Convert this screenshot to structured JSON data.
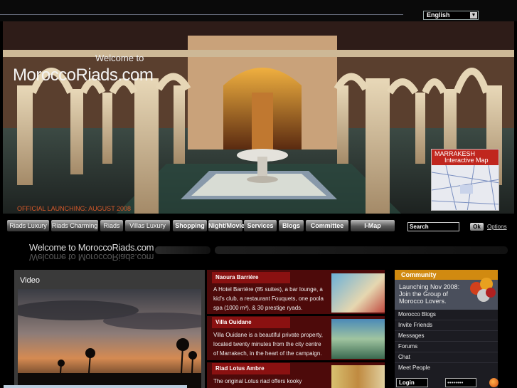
{
  "language": {
    "selected": "English",
    "arrow_icon": "chevron-down-icon"
  },
  "hero": {
    "welcome_small": "Welcome to",
    "welcome_big": "MoroccoRiads.com",
    "launch_text": "OFFICIAL LAUNCHING: AUGUST 2008",
    "map_title_1": "MARRAKESH",
    "map_title_2": "Interactive Map"
  },
  "nav": {
    "items": [
      "Riads Luxury",
      "Riads Charming",
      "Riads",
      "Villas Luxury",
      "Shopping",
      "Night/Movie",
      "Services",
      "Blogs",
      "Committee",
      "I-Map"
    ],
    "search_value": "Search",
    "ok_label": "Ok",
    "options_label": "Options"
  },
  "tagline": "Welcome to MoroccoRiads.com",
  "video": {
    "title": "Video"
  },
  "news": [
    {
      "title": "Naoura Barrière",
      "text": "A Hotel Barrière (85 suites), a bar lounge, a kid's club, a restaurant Fouquets, one poola spa (1000 m²), & 30 prestige ryads."
    },
    {
      "title": "Villa Ouidane",
      "text": "Villa Ouidane is a beautiful private property, located twenty minutes from the city centre of Marrakech, in the heart of the campaign."
    },
    {
      "title": "Riad Lotus Ambre",
      "text": "The original Lotus riad offers kooky"
    }
  ],
  "community": {
    "title": "Community",
    "banner_lines": [
      "Launching Nov 2008:",
      "Join the Group of",
      "Morocco Lovers."
    ],
    "links": [
      "Morocco Blogs",
      "Invite Friends",
      "Messages",
      "Forums",
      "Chat",
      "Meet People"
    ],
    "login_label": "Login",
    "password_value": "••••••••"
  },
  "colors": {
    "nav_gradient_top": "#bbbbbb",
    "news_bg": "#4d0a0a",
    "news_head": "#8a1111",
    "community_head": "#d18a10"
  }
}
